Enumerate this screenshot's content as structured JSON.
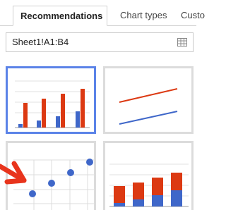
{
  "tabs": [
    {
      "label": "Recommendations",
      "active": true
    },
    {
      "label": "Chart types",
      "active": false
    },
    {
      "label": "Custo",
      "active": false
    }
  ],
  "range_input": {
    "value": "Sheet1!A1:B4",
    "icon": "grid-icon"
  },
  "thumbnails": [
    {
      "name": "column-chart",
      "selected": true
    },
    {
      "name": "line-chart",
      "selected": false
    },
    {
      "name": "scatter-chart",
      "selected": false
    },
    {
      "name": "stacked-column-chart",
      "selected": false
    }
  ],
  "colors": {
    "series_blue": "#3f67c9",
    "series_red": "#dc3912",
    "selected_border": "#5b83e8",
    "arrow": "#e8341c"
  },
  "icons": {
    "arrow": "red-pointer-arrow"
  }
}
